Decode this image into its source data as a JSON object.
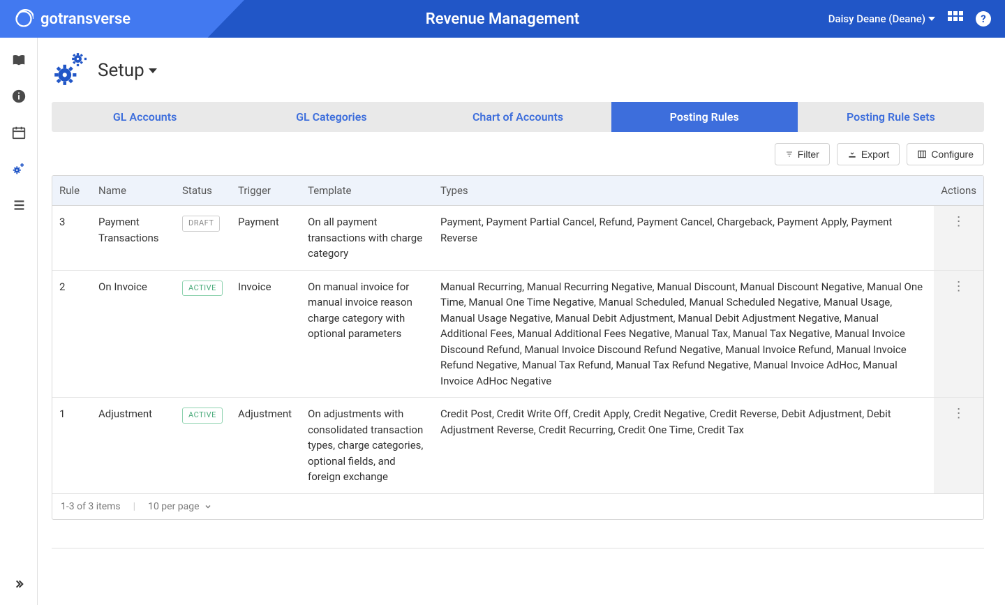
{
  "header": {
    "brand": "gotransverse",
    "title": "Revenue Management",
    "user": "Daisy Deane (Deane)"
  },
  "page": {
    "title": "Setup"
  },
  "tabs": [
    {
      "label": "GL Accounts",
      "active": false
    },
    {
      "label": "GL Categories",
      "active": false
    },
    {
      "label": "Chart of Accounts",
      "active": false
    },
    {
      "label": "Posting Rules",
      "active": true
    },
    {
      "label": "Posting Rule Sets",
      "active": false
    }
  ],
  "toolbar": {
    "filter": "Filter",
    "export": "Export",
    "configure": "Configure"
  },
  "table": {
    "headers": {
      "rule": "Rule",
      "name": "Name",
      "status": "Status",
      "trigger": "Trigger",
      "template": "Template",
      "types": "Types",
      "actions": "Actions"
    },
    "rows": [
      {
        "rule": "3",
        "name": "Payment Transactions",
        "status": "DRAFT",
        "trigger": "Payment",
        "template": "On all payment transactions with charge category",
        "types": "Payment, Payment Partial Cancel, Refund, Payment Cancel, Chargeback, Payment Apply, Payment Reverse"
      },
      {
        "rule": "2",
        "name": "On Invoice",
        "status": "ACTIVE",
        "trigger": "Invoice",
        "template": "On manual invoice for manual invoice reason charge category with optional parameters",
        "types": "Manual Recurring, Manual Recurring Negative, Manual Discount, Manual Discount Negative, Manual One Time, Manual One Time Negative, Manual Scheduled, Manual Scheduled Negative, Manual Usage, Manual Usage Negative, Manual Debit Adjustment, Manual Debit Adjustment Negative, Manual Additional Fees, Manual Additional Fees Negative, Manual Tax, Manual Tax Negative, Manual Invoice Discound Refund, Manual Invoice Discound Refund Negative, Manual Invoice Refund, Manual Invoice Refund Negative, Manual Tax Refund, Manual Tax Refund Negative, Manual Invoice AdHoc, Manual Invoice AdHoc Negative"
      },
      {
        "rule": "1",
        "name": "Adjustment",
        "status": "ACTIVE",
        "trigger": "Adjustment",
        "template": "On adjustments with consolidated transaction types, charge categories, optional fields, and foreign exchange",
        "types": "Credit Post, Credit Write Off, Credit Apply, Credit Negative, Credit Reverse, Debit Adjustment, Debit Adjustment Reverse, Credit Recurring, Credit One Time, Credit Tax"
      }
    ]
  },
  "pagination": {
    "summary": "1-3 of 3 items",
    "per_page": "10 per page"
  }
}
